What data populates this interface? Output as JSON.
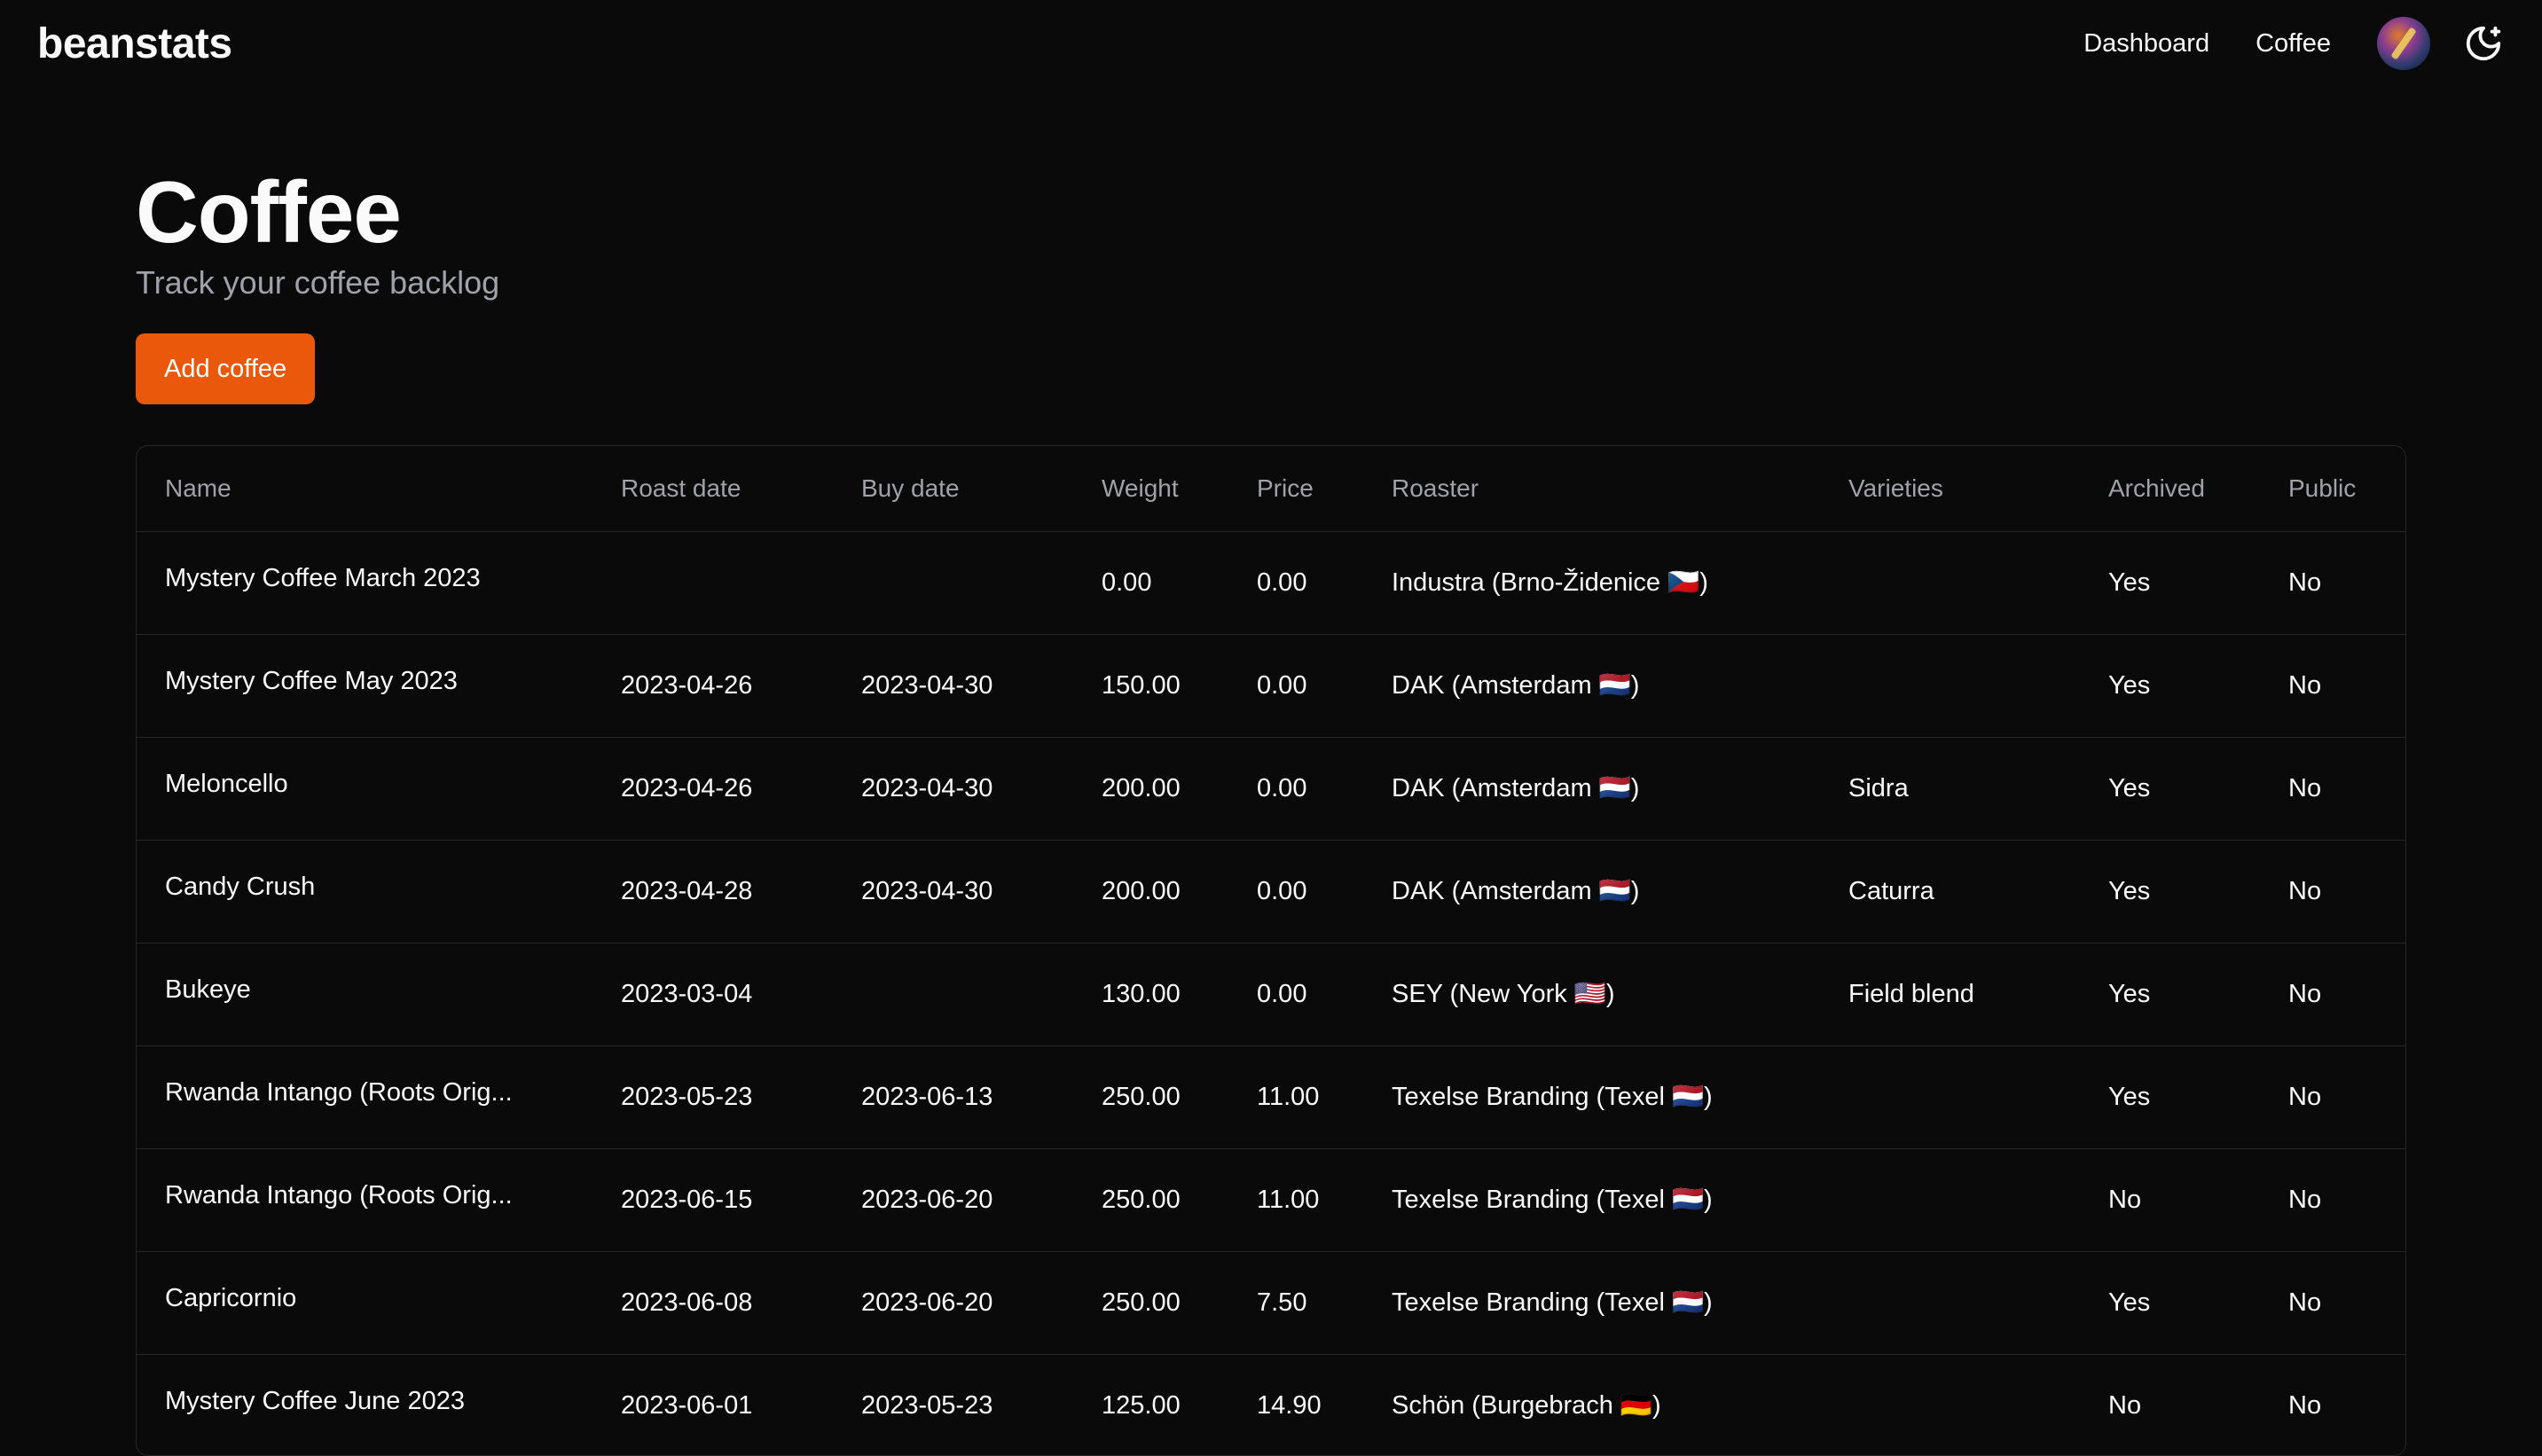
{
  "app": {
    "brand": "beanstats"
  },
  "nav": {
    "dashboard": "Dashboard",
    "coffee": "Coffee"
  },
  "page": {
    "title": "Coffee",
    "subtitle": "Track your coffee backlog",
    "add_button": "Add coffee"
  },
  "table": {
    "columns": [
      "Name",
      "Roast date",
      "Buy date",
      "Weight",
      "Price",
      "Roaster",
      "Varieties",
      "Archived",
      "Public"
    ],
    "rows": [
      {
        "name": "Mystery Coffee March 2023",
        "roast_date": "",
        "buy_date": "",
        "weight": "0.00",
        "price": "0.00",
        "roaster": "Industra (Brno-Židenice 🇨🇿)",
        "varieties": "",
        "archived": "Yes",
        "public": "No"
      },
      {
        "name": "Mystery Coffee May 2023",
        "roast_date": "2023-04-26",
        "buy_date": "2023-04-30",
        "weight": "150.00",
        "price": "0.00",
        "roaster": "DAK (Amsterdam 🇳🇱)",
        "varieties": "",
        "archived": "Yes",
        "public": "No"
      },
      {
        "name": "Meloncello",
        "roast_date": "2023-04-26",
        "buy_date": "2023-04-30",
        "weight": "200.00",
        "price": "0.00",
        "roaster": "DAK (Amsterdam 🇳🇱)",
        "varieties": "Sidra",
        "archived": "Yes",
        "public": "No"
      },
      {
        "name": "Candy Crush",
        "roast_date": "2023-04-28",
        "buy_date": "2023-04-30",
        "weight": "200.00",
        "price": "0.00",
        "roaster": "DAK (Amsterdam 🇳🇱)",
        "varieties": "Caturra",
        "archived": "Yes",
        "public": "No"
      },
      {
        "name": "Bukeye",
        "roast_date": "2023-03-04",
        "buy_date": "",
        "weight": "130.00",
        "price": "0.00",
        "roaster": "SEY (New York 🇺🇸)",
        "varieties": "Field blend",
        "archived": "Yes",
        "public": "No"
      },
      {
        "name": "Rwanda Intango (Roots Orig...",
        "roast_date": "2023-05-23",
        "buy_date": "2023-06-13",
        "weight": "250.00",
        "price": "11.00",
        "roaster": "Texelse Branding (Texel 🇳🇱)",
        "varieties": "",
        "archived": "Yes",
        "public": "No"
      },
      {
        "name": "Rwanda Intango (Roots Orig...",
        "roast_date": "2023-06-15",
        "buy_date": "2023-06-20",
        "weight": "250.00",
        "price": "11.00",
        "roaster": "Texelse Branding (Texel 🇳🇱)",
        "varieties": "",
        "archived": "No",
        "public": "No"
      },
      {
        "name": "Capricornio",
        "roast_date": "2023-06-08",
        "buy_date": "2023-06-20",
        "weight": "250.00",
        "price": "7.50",
        "roaster": "Texelse Branding (Texel 🇳🇱)",
        "varieties": "",
        "archived": "Yes",
        "public": "No"
      },
      {
        "name": "Mystery Coffee June 2023",
        "roast_date": "2023-06-01",
        "buy_date": "2023-05-23",
        "weight": "125.00",
        "price": "14.90",
        "roaster": "Schön (Burgebrach 🇩🇪)",
        "varieties": "",
        "archived": "No",
        "public": "No"
      }
    ]
  },
  "icons": {
    "avatar": "user-avatar",
    "theme": "moon-star-icon"
  },
  "colors": {
    "background": "#0a0a0a",
    "accent": "#ea580c",
    "border": "#27272a",
    "muted": "#a1a1aa"
  }
}
